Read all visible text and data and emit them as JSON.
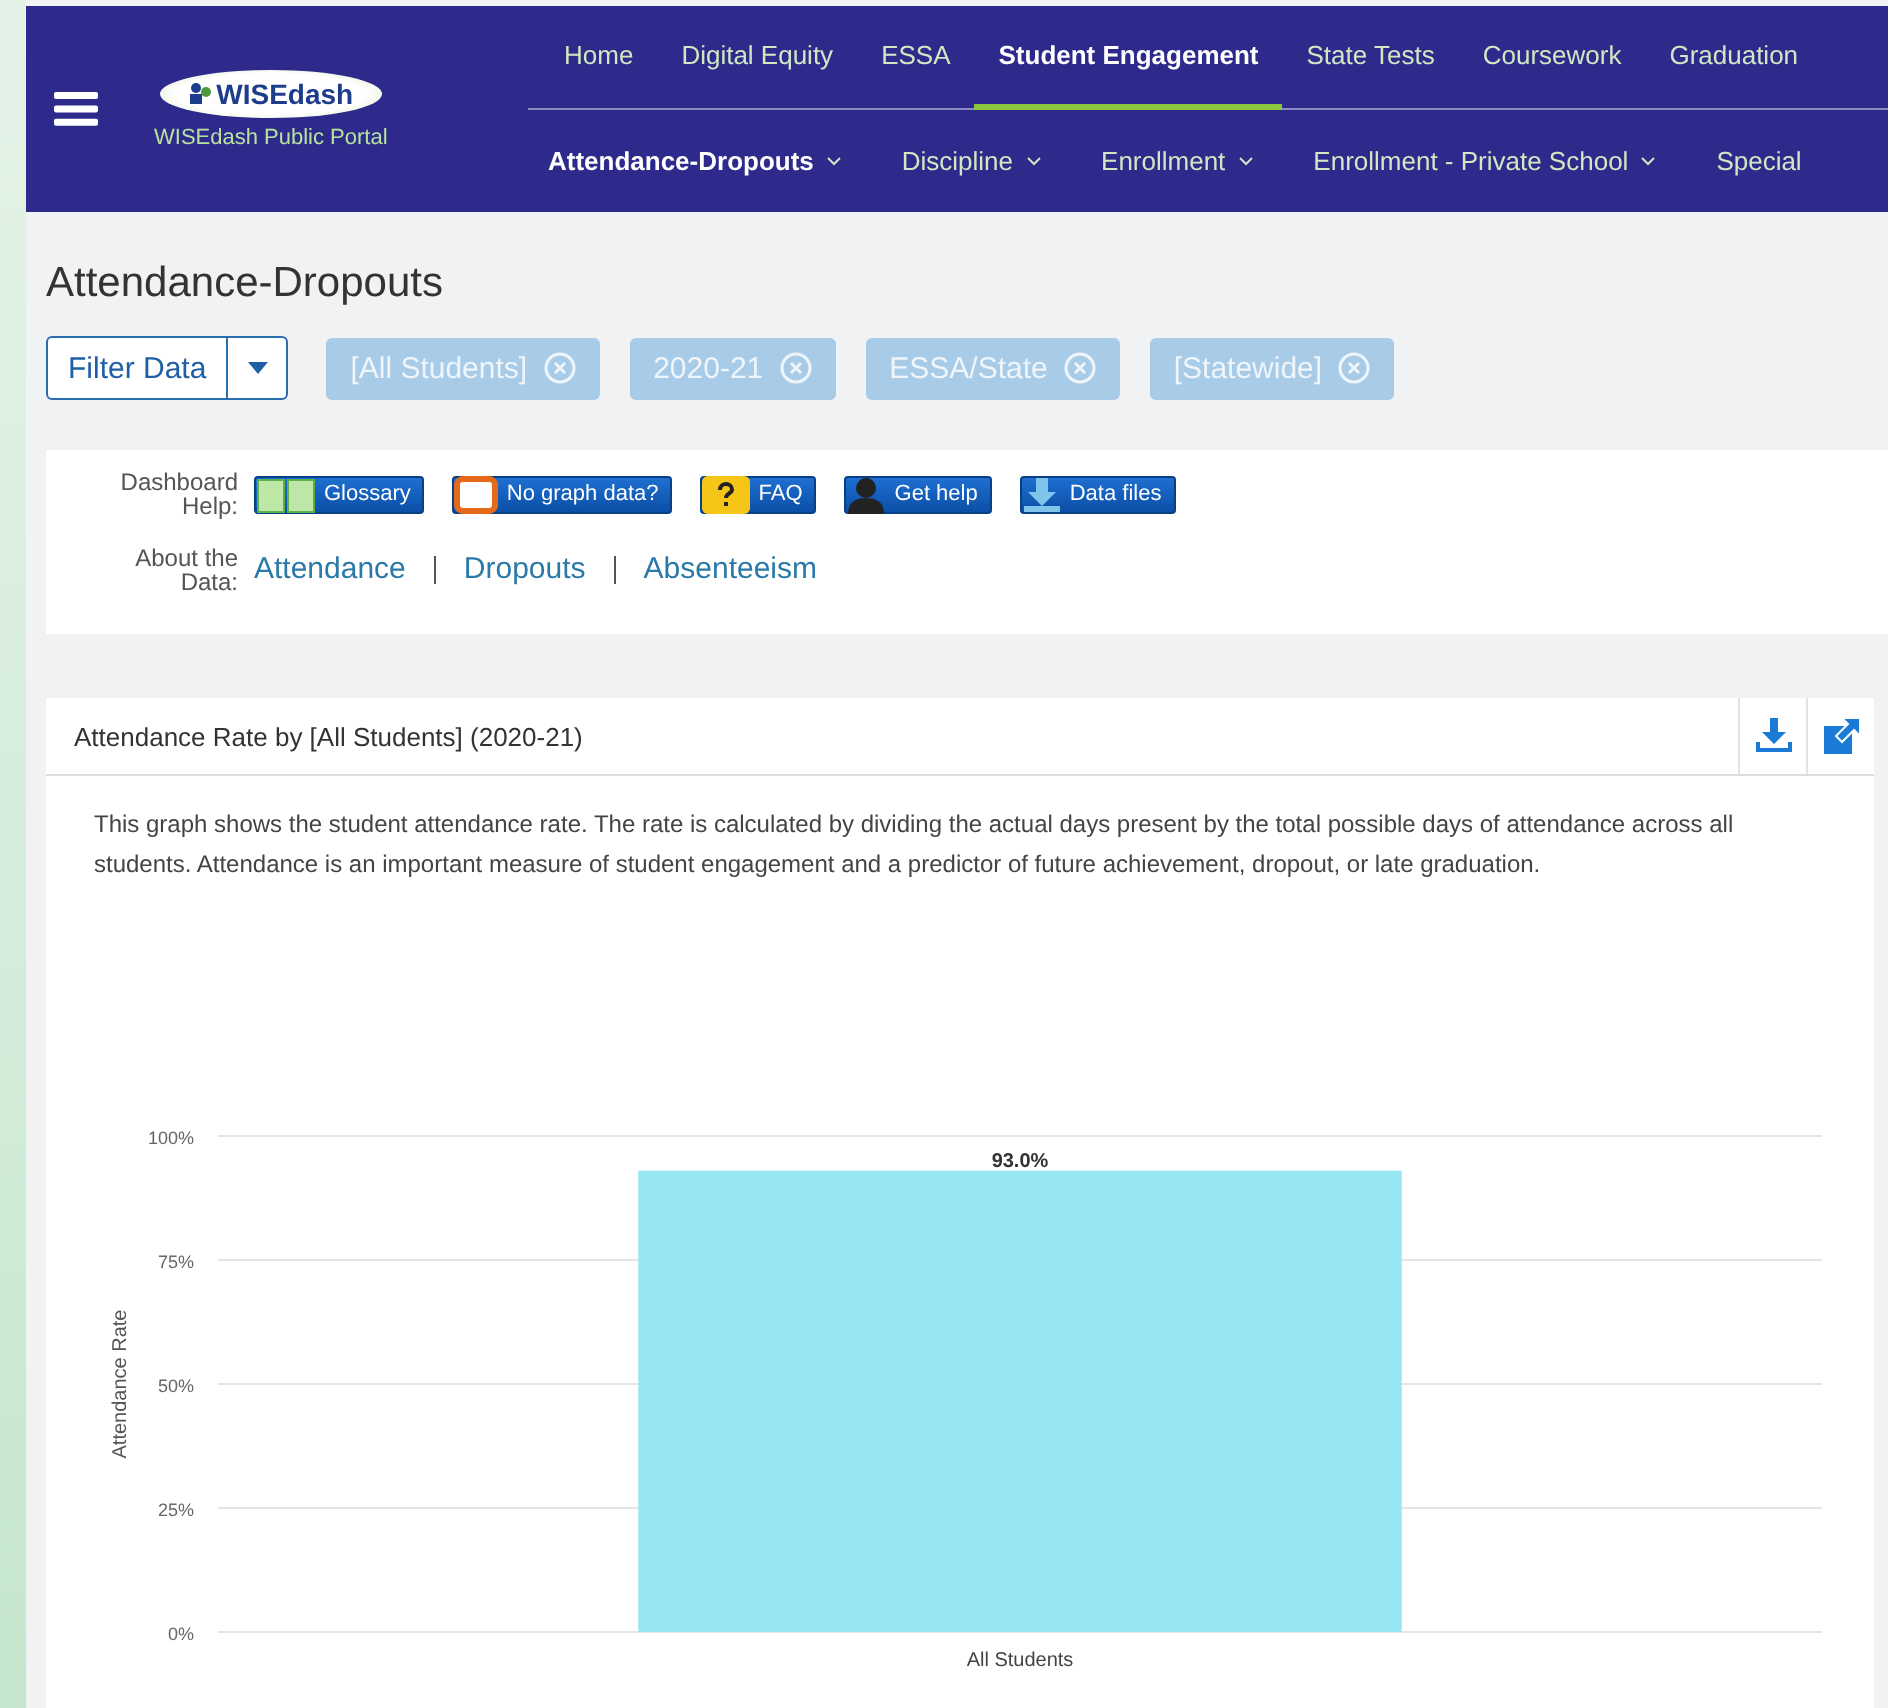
{
  "header": {
    "logo": "WISEdash",
    "portal": "WISEdash Public Portal",
    "nav": [
      {
        "label": "Home",
        "selected": false
      },
      {
        "label": "Digital Equity",
        "selected": false
      },
      {
        "label": "ESSA",
        "selected": false
      },
      {
        "label": "Student Engagement",
        "selected": true
      },
      {
        "label": "State Tests",
        "selected": false
      },
      {
        "label": "Coursework",
        "selected": false
      },
      {
        "label": "Graduation",
        "selected": false
      }
    ],
    "subnav": [
      {
        "label": "Attendance-Dropouts",
        "selected": true,
        "dropdown": true
      },
      {
        "label": "Discipline",
        "selected": false,
        "dropdown": true
      },
      {
        "label": "Enrollment",
        "selected": false,
        "dropdown": true
      },
      {
        "label": "Enrollment - Private School",
        "selected": false,
        "dropdown": true
      },
      {
        "label": "Special",
        "selected": false,
        "dropdown": false
      }
    ]
  },
  "page_title": "Attendance-Dropouts",
  "filter_button": "Filter Data",
  "filters": [
    "[All Students]",
    "2020-21",
    "ESSA/State",
    "[Statewide]"
  ],
  "help": {
    "label_1": "Dashboard",
    "label_2": "Help:",
    "buttons": [
      {
        "kind": "book",
        "label": "Glossary"
      },
      {
        "kind": "blank",
        "label": "No graph data?"
      },
      {
        "kind": "question",
        "label": "FAQ"
      },
      {
        "kind": "person",
        "label": "Get help"
      },
      {
        "kind": "download",
        "label": "Data files"
      }
    ],
    "about_1": "About the",
    "about_2": "Data:",
    "links": [
      "Attendance",
      "Dropouts",
      "Absenteeism"
    ]
  },
  "chart_card": {
    "title": "Attendance Rate by [All Students] (2020-21)",
    "description": "This graph shows the student attendance rate. The rate is calculated by dividing the actual days present by the total possible days of attendance across all students. Attendance is an important measure of student engagement and a predictor of future achievement, dropout, or late graduation.",
    "chart_data": {
      "type": "bar",
      "ylabel": "Attendance Rate",
      "categories": [
        "All Students"
      ],
      "series": [
        {
          "color": "#97e6f4",
          "values": [
            93.0
          ]
        }
      ],
      "grid": true,
      "ylim": [
        0,
        100
      ],
      "yticks": [
        {
          "value": 0,
          "label": "0%"
        },
        {
          "value": 25,
          "label": "25%"
        },
        {
          "value": 50,
          "label": "50%"
        },
        {
          "value": 75,
          "label": "75%"
        },
        {
          "value": 100,
          "label": "100%"
        }
      ],
      "value_labels": [
        "93.0%"
      ]
    }
  }
}
